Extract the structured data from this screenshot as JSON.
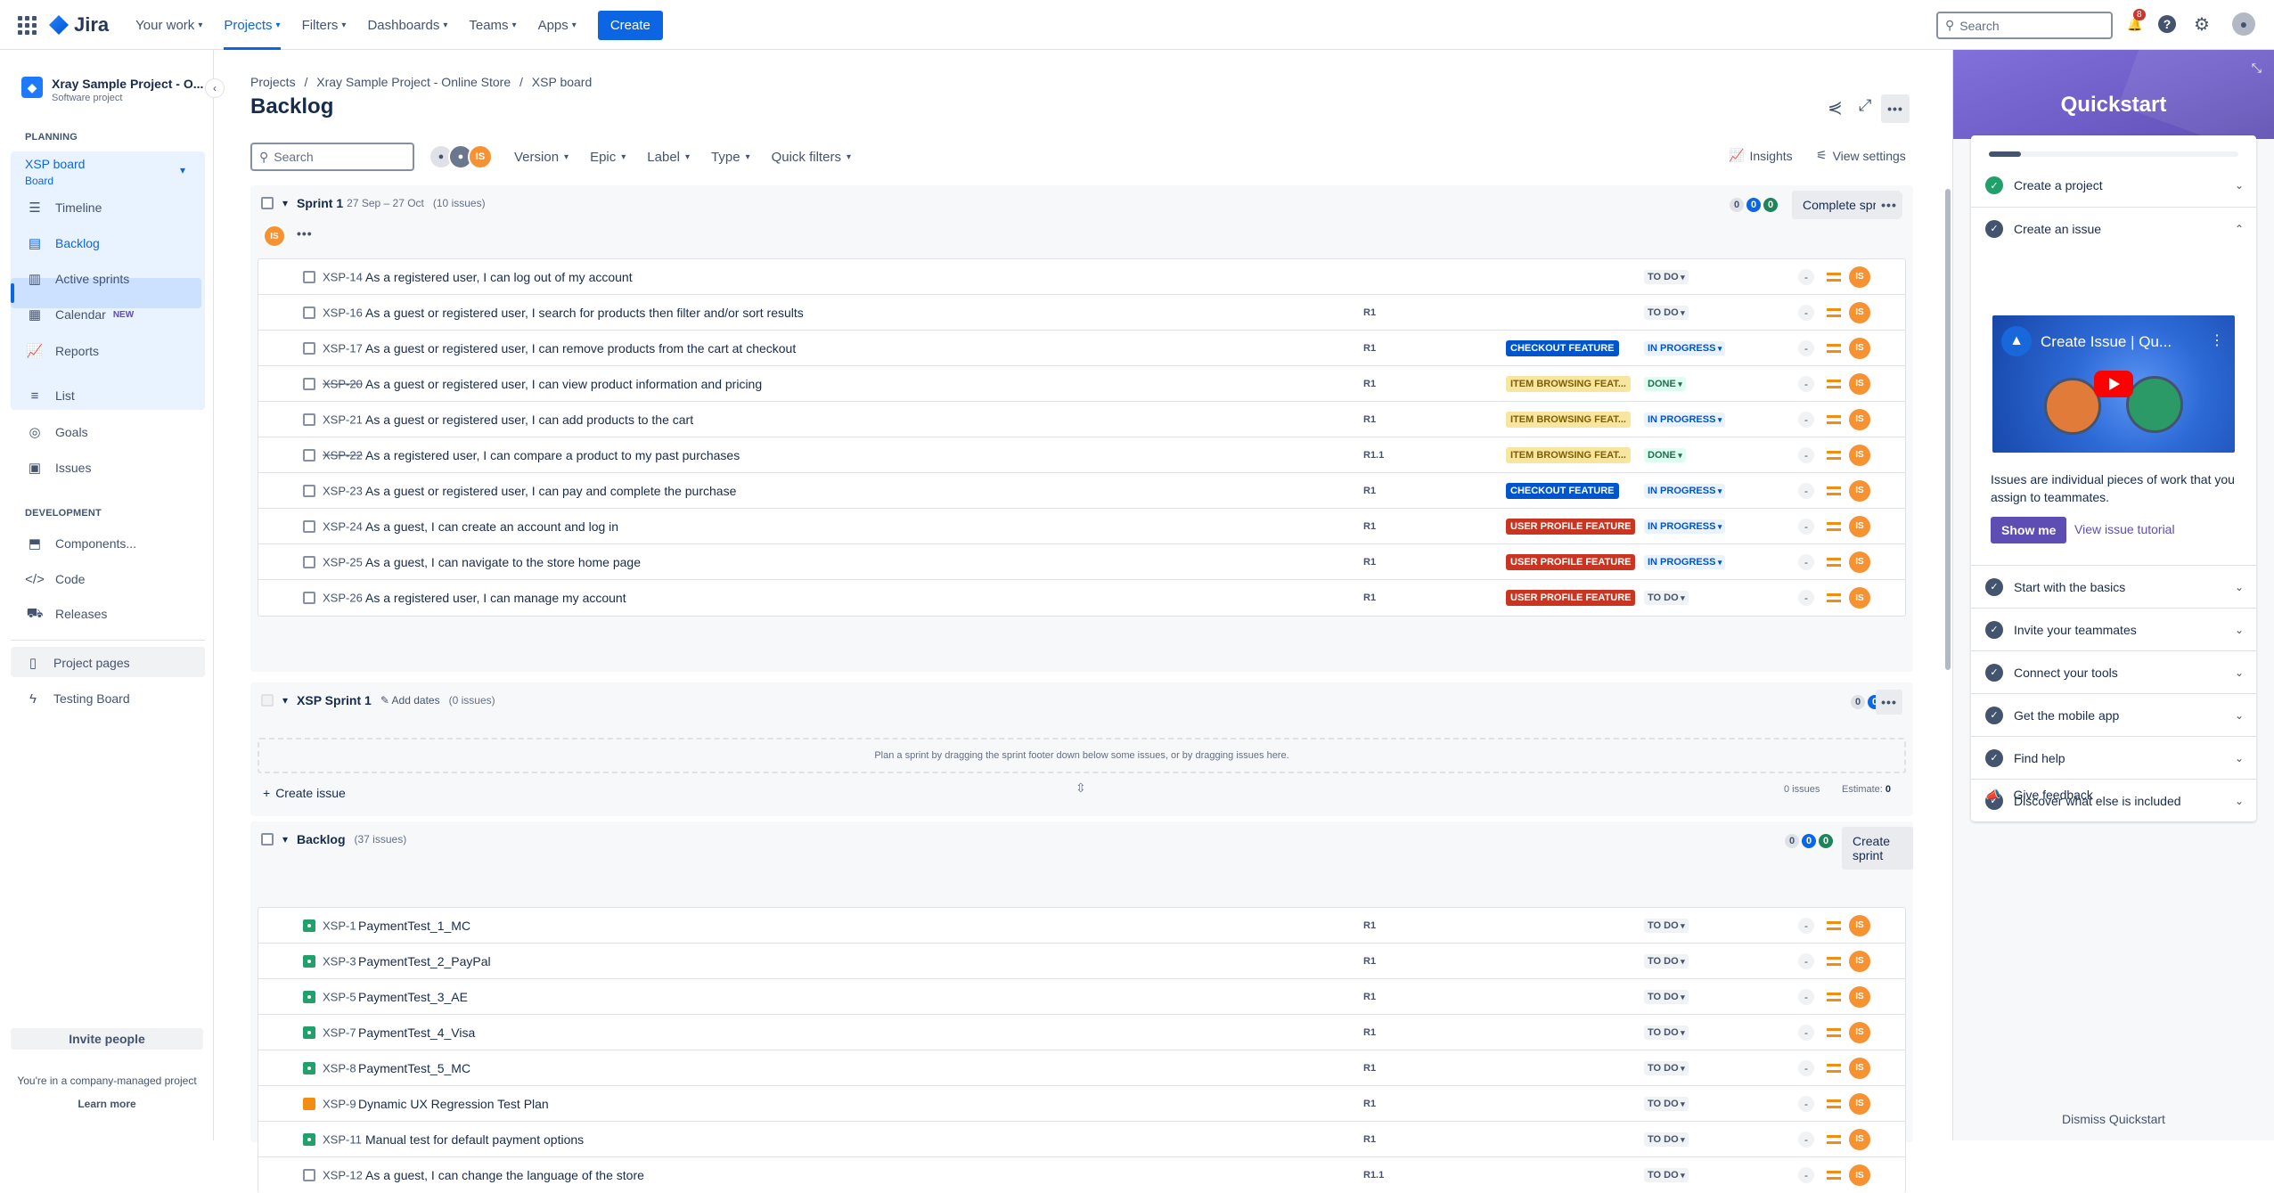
{
  "topnav": {
    "logo": "Jira",
    "items": [
      "Your work",
      "Projects",
      "Filters",
      "Dashboards",
      "Teams",
      "Apps"
    ],
    "create": "Create",
    "search_placeholder": "Search",
    "notif_count": "8"
  },
  "sidebar": {
    "project_name": "Xray Sample Project - O...",
    "project_type": "Software project",
    "planning_label": "PLANNING",
    "board_name": "XSP board",
    "board_sub": "Board",
    "planning_items": [
      "Timeline",
      "Backlog",
      "Active sprints",
      "Calendar",
      "Reports"
    ],
    "calendar_badge": "NEW",
    "other_items": [
      "List",
      "Goals",
      "Issues"
    ],
    "development_label": "DEVELOPMENT",
    "dev_items": [
      "Components...",
      "Code",
      "Releases"
    ],
    "extra_items": [
      "Project pages",
      "Testing Board"
    ],
    "invite": "Invite people",
    "managed_note": "You're in a company-managed project",
    "learn_more": "Learn more"
  },
  "header": {
    "breadcrumbs": [
      "Projects",
      "Xray Sample Project - Online Store",
      "XSP board"
    ],
    "title": "Backlog"
  },
  "filters": {
    "search_placeholder": "Search",
    "avatar_initials": "IS",
    "dropdowns": [
      "Version",
      "Epic",
      "Label",
      "Type",
      "Quick filters"
    ],
    "insights": "Insights",
    "view_settings": "View settings"
  },
  "sprint1": {
    "name": "Sprint 1",
    "dates": "27 Sep – 27 Oct",
    "issue_count": "(10 issues)",
    "counts": [
      "0",
      "0",
      "0"
    ],
    "action": "Complete sprint",
    "assignee": "IS",
    "issues": [
      {
        "key": "XSP-14",
        "summary": "As a registered user, I can log out of my account",
        "version": "",
        "epic": "",
        "status": "TO DO",
        "done": false
      },
      {
        "key": "XSP-16",
        "summary": "As a guest or registered user, I search for products then filter and/or sort results",
        "version": "R1",
        "epic": "",
        "status": "TO DO",
        "done": false
      },
      {
        "key": "XSP-17",
        "summary": "As a guest or registered user, I can remove products from the cart at checkout",
        "version": "R1",
        "epic": "CHECKOUT FEATURE",
        "status": "IN PROGRESS",
        "done": false
      },
      {
        "key": "XSP-20",
        "summary": "As a guest or registered user, I can view product information and pricing",
        "version": "R1",
        "epic": "ITEM BROWSING FEAT...",
        "status": "DONE",
        "done": true
      },
      {
        "key": "XSP-21",
        "summary": "As a guest or registered user, I can add products to the cart",
        "version": "R1",
        "epic": "ITEM BROWSING FEAT...",
        "status": "IN PROGRESS",
        "done": false
      },
      {
        "key": "XSP-22",
        "summary": "As a registered user, I can compare a product to my past purchases",
        "version": "R1.1",
        "epic": "ITEM BROWSING FEAT...",
        "status": "DONE",
        "done": true
      },
      {
        "key": "XSP-23",
        "summary": "As a guest or registered user, I can pay and complete the purchase",
        "version": "R1",
        "epic": "CHECKOUT FEATURE",
        "status": "IN PROGRESS",
        "done": false
      },
      {
        "key": "XSP-24",
        "summary": "As a guest, I can create an account and log in",
        "version": "R1",
        "epic": "USER PROFILE FEATURE",
        "status": "IN PROGRESS",
        "done": false
      },
      {
        "key": "XSP-25",
        "summary": "As a guest, I can navigate to the store home page",
        "version": "R1",
        "epic": "USER PROFILE FEATURE",
        "status": "IN PROGRESS",
        "done": false
      },
      {
        "key": "XSP-26",
        "summary": "As a registered user, I can manage my account",
        "version": "R1",
        "epic": "USER PROFILE FEATURE",
        "status": "TO DO",
        "done": false
      }
    ]
  },
  "sprint2": {
    "name": "XSP Sprint 1",
    "add_dates": "Add dates",
    "issue_count": "(0 issues)",
    "counts": [
      "0",
      "0",
      "0"
    ],
    "empty_text": "Plan a sprint by dragging the sprint footer down below some issues, or by dragging issues here.",
    "create_issue": "Create issue",
    "footer_issues": "0 issues",
    "estimate_label": "Estimate:",
    "estimate_value": "0"
  },
  "backlog": {
    "name": "Backlog",
    "issue_count": "(37 issues)",
    "counts": [
      "0",
      "0",
      "0"
    ],
    "action": "Create sprint",
    "issues": [
      {
        "key": "XSP-1",
        "summary": "PaymentTest_1_MC",
        "version": "R1",
        "status": "TO DO",
        "type": "test"
      },
      {
        "key": "XSP-3",
        "summary": "PaymentTest_2_PayPal",
        "version": "R1",
        "status": "TO DO",
        "type": "test"
      },
      {
        "key": "XSP-5",
        "summary": "PaymentTest_3_AE",
        "version": "R1",
        "status": "TO DO",
        "type": "test"
      },
      {
        "key": "XSP-7",
        "summary": "PaymentTest_4_Visa",
        "version": "R1",
        "status": "TO DO",
        "type": "test"
      },
      {
        "key": "XSP-8",
        "summary": "PaymentTest_5_MC",
        "version": "R1",
        "status": "TO DO",
        "type": "test"
      },
      {
        "key": "XSP-9",
        "summary": "Dynamic UX Regression Test Plan",
        "version": "R1",
        "status": "TO DO",
        "type": "plan"
      },
      {
        "key": "XSP-11",
        "summary": "Manual test for default payment options",
        "version": "R1",
        "status": "TO DO",
        "type": "test"
      },
      {
        "key": "XSP-12",
        "summary": "As a guest, I can change the language of the store",
        "version": "R1.1",
        "status": "TO DO",
        "type": "story"
      }
    ]
  },
  "quickstart": {
    "title": "Quickstart",
    "items": [
      "Create a project",
      "Create an issue",
      "Start with the basics",
      "Invite your teammates",
      "Connect your tools",
      "Get the mobile app",
      "Find help",
      "Discover what else is included"
    ],
    "video_title": "Create Issue | Qu...",
    "description": "Issues are individual pieces of work that you assign to teammates.",
    "show_me": "Show me",
    "tutorial": "View issue tutorial",
    "feedback": "Give feedback",
    "dismiss": "Dismiss Quickstart"
  },
  "colors": {
    "accent": "#0c66e4",
    "checkout": "#0055cc",
    "browsing": "#f8e6a0",
    "profile": "#ca3521"
  }
}
